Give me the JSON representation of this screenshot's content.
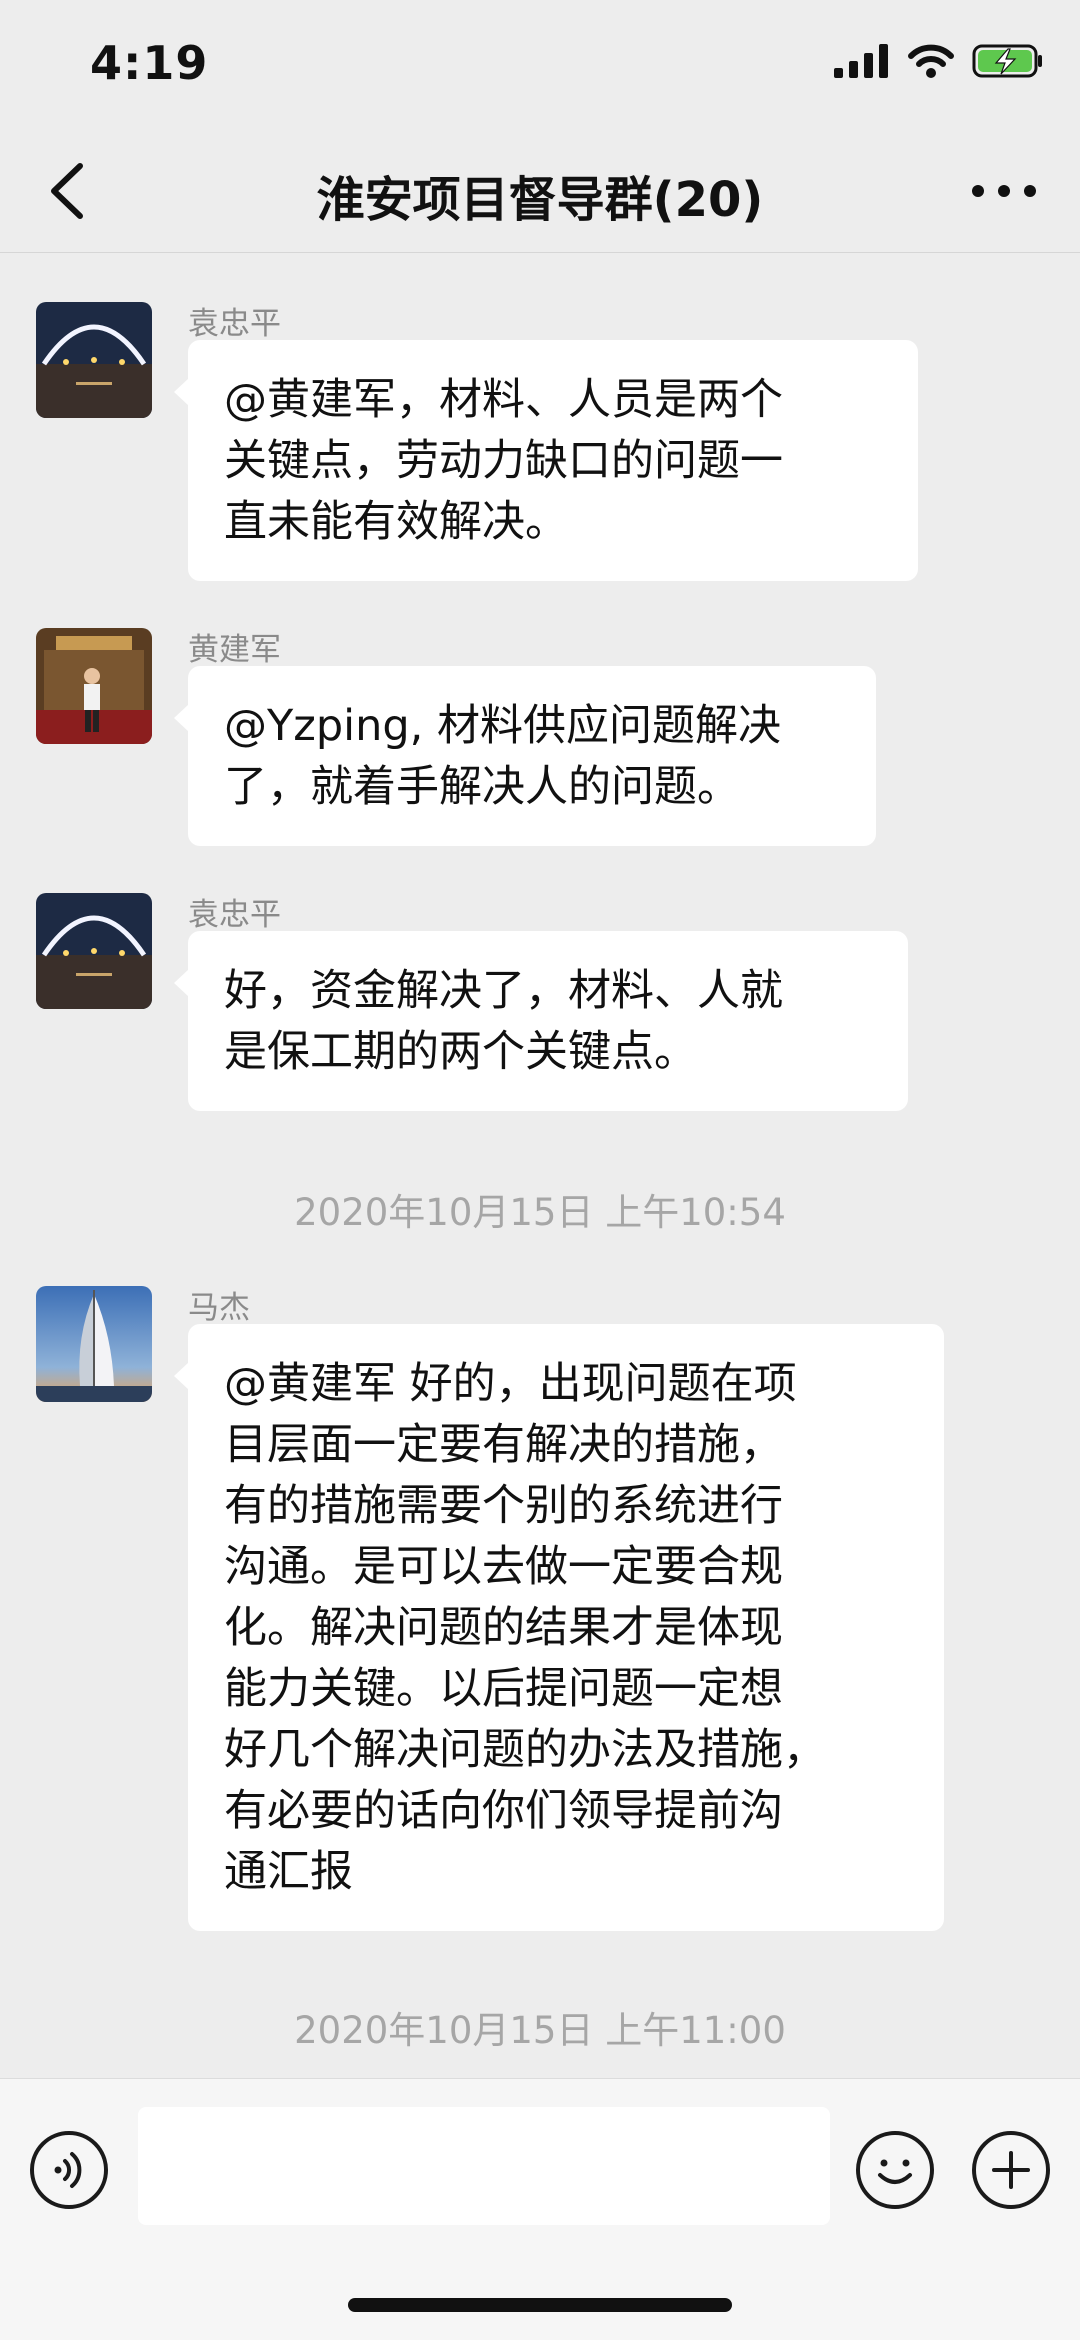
{
  "status_bar": {
    "time": "4:19",
    "icons": [
      "signal-icon",
      "wifi-icon",
      "battery-charging-icon"
    ]
  },
  "nav": {
    "title": "淮安项目督导群(20)",
    "back_icon": "chevron-left-icon",
    "more_icon": "more-icon"
  },
  "messages": [
    {
      "sender": "袁忠平",
      "avatar": "night-arch-photo",
      "lines": [
        "@黄建军，材料、人员是两个",
        "关键点，劳动力缺口的问题一",
        "直未能有效解决。"
      ]
    },
    {
      "sender": "黄建军",
      "avatar": "person-indoor-photo",
      "lines": [
        "@Yzping, 材料供应问题解决",
        "了，就着手解决人的问题。"
      ]
    },
    {
      "sender": "袁忠平",
      "avatar": "night-arch-photo",
      "lines": [
        "好，资金解决了，材料、人就",
        "是保工期的两个关键点。"
      ]
    },
    {
      "sender": "马杰",
      "avatar": "sail-hotel-photo",
      "lines": [
        "@黄建军 好的，出现问题在项",
        "目层面一定要有解决的措施，",
        "有的措施需要个别的系统进行",
        "沟通。是可以去做一定要合规",
        "化。解决问题的结果才是体现",
        "能力关键。以后提问题一定想",
        "好几个解决问题的办法及措施，",
        "有必要的话向你们领导提前沟",
        "通汇报"
      ]
    }
  ],
  "timestamps": [
    "2020年10月15日 上午10:54",
    "2020年10月15日 上午11:00"
  ],
  "input_bar": {
    "voice_icon": "voice-icon",
    "emoji_icon": "emoji-icon",
    "plus_icon": "plus-icon",
    "value": ""
  }
}
